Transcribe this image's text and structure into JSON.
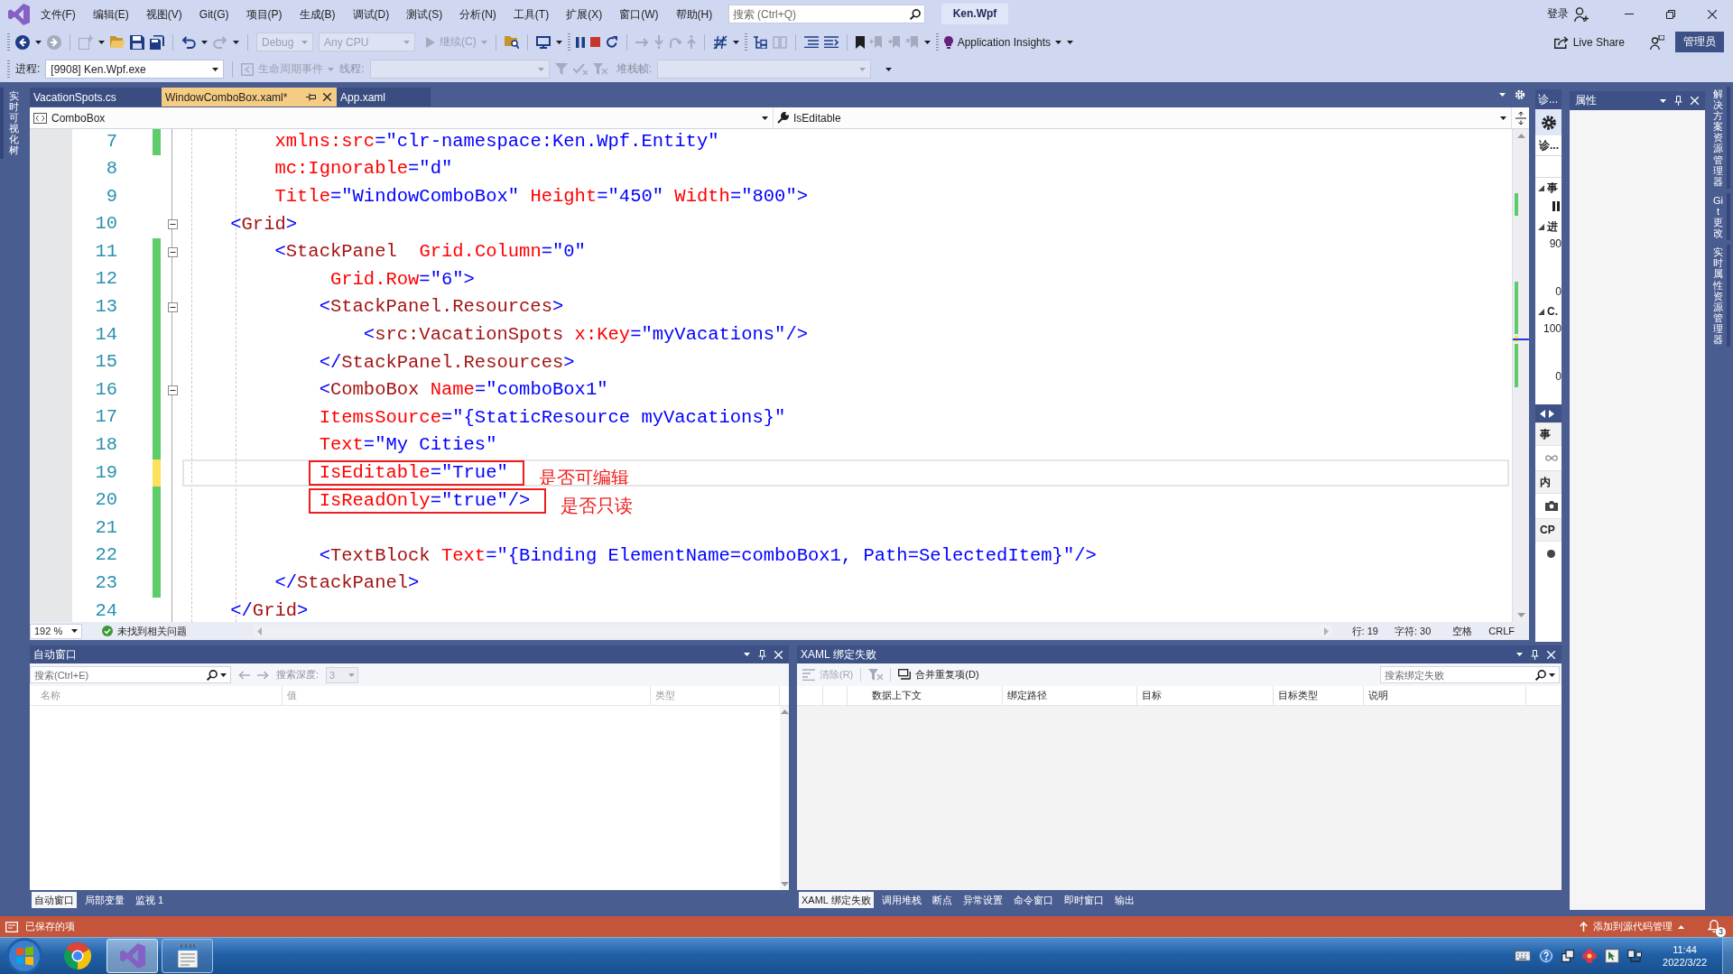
{
  "menu_bar": {
    "items": [
      "文件(F)",
      "编辑(E)",
      "视图(V)",
      "Git(G)",
      "项目(P)",
      "生成(B)",
      "调试(D)",
      "测试(S)",
      "分析(N)",
      "工具(T)",
      "扩展(X)",
      "窗口(W)",
      "帮助(H)"
    ],
    "search": {
      "placeholder": "搜索 (Ctrl+Q)"
    },
    "solution_name": "Ken.Wpf",
    "sign_in": "登录"
  },
  "standard_toolbar": {
    "configuration": {
      "value": "Debug",
      "disabled": true
    },
    "platform": {
      "value": "Any CPU",
      "disabled": true
    },
    "continue": {
      "label": "继续(C)",
      "disabled": true
    },
    "application_insights": "Application Insights",
    "live_share": "Live Share",
    "admin_badge": "管理员"
  },
  "debug_location_toolbar": {
    "process_label": "进程:",
    "process": "[9908] Ken.Wpf.exe",
    "lifecycle_events": {
      "label": "生命周期事件",
      "disabled": true
    },
    "thread": {
      "label": "线程:",
      "disabled": true
    },
    "stack_frame": {
      "label": "堆栈帧:",
      "disabled": true
    }
  },
  "left_rail": [
    "实时可视化树"
  ],
  "document_tabs": [
    {
      "label": "VacationSpots.cs",
      "selected": false
    },
    {
      "label": "WindowComboBox.xaml*",
      "selected": true
    },
    {
      "label": "App.xaml",
      "selected": false
    }
  ],
  "navigation_bar": {
    "scope": "ComboBox",
    "member": "IsEditable"
  },
  "editor": {
    "lines": [
      {
        "number": "7",
        "text": "        xmlns:src=\"clr-namespace:Ken.Wpf.Entity\"",
        "changed": true,
        "color": "#5fcc6a",
        "foldable": false,
        "current": false
      },
      {
        "number": "8",
        "text": "        mc:Ignorable=\"d\"",
        "changed": false,
        "foldable": false,
        "current": false
      },
      {
        "number": "9",
        "text": "        Title=\"WindowComboBox\" Height=\"450\" Width=\"800\">",
        "changed": false,
        "foldable": false,
        "current": false
      },
      {
        "number": "10",
        "text": "    <Grid>",
        "changed": false,
        "foldable": true,
        "current": false
      },
      {
        "number": "11",
        "text": "        <StackPanel  Grid.Column=\"0\"",
        "changed": true,
        "color": "#5fcc6a",
        "foldable": true,
        "current": false
      },
      {
        "number": "12",
        "text": "             Grid.Row=\"6\">",
        "changed": true,
        "color": "#5fcc6a",
        "foldable": false,
        "current": false
      },
      {
        "number": "13",
        "text": "            <StackPanel.Resources>",
        "changed": true,
        "color": "#5fcc6a",
        "foldable": true,
        "current": false
      },
      {
        "number": "14",
        "text": "                <src:VacationSpots x:Key=\"myVacations\"/>",
        "changed": true,
        "color": "#5fcc6a",
        "foldable": false,
        "current": false
      },
      {
        "number": "15",
        "text": "            </StackPanel.Resources>",
        "changed": true,
        "color": "#5fcc6a",
        "foldable": false,
        "current": false
      },
      {
        "number": "16",
        "text": "            <ComboBox Name=\"comboBox1\"",
        "changed": true,
        "color": "#5fcc6a",
        "foldable": true,
        "current": false
      },
      {
        "number": "17",
        "text": "            ItemsSource=\"{StaticResource myVacations}\"",
        "changed": true,
        "color": "#5fcc6a",
        "foldable": false,
        "current": false
      },
      {
        "number": "18",
        "text": "            Text=\"My Cities\"",
        "changed": true,
        "color": "#5fcc6a",
        "foldable": false,
        "current": false
      },
      {
        "number": "19",
        "text": "            IsEditable=\"True\"",
        "changed": true,
        "color": "#fde15a",
        "foldable": false,
        "current": true,
        "note": "是否可编辑"
      },
      {
        "number": "20",
        "text": "            IsReadOnly=\"true\"/>",
        "changed": true,
        "color": "#5fcc6a",
        "foldable": false,
        "current": false,
        "note": "是否只读"
      },
      {
        "number": "21",
        "changed": true,
        "color": "#5fcc6a",
        "foldable": false,
        "current": false
      },
      {
        "number": "22",
        "text": "            <TextBlock Text=\"{Binding ElementName=comboBox1, Path=SelectedItem}\"/>",
        "changed": true,
        "color": "#5fcc6a",
        "foldable": false,
        "current": false
      },
      {
        "number": "23",
        "text": "        </StackPanel>",
        "changed": true,
        "color": "#5fcc6a",
        "foldable": false,
        "current": false
      },
      {
        "number": "24",
        "text": "    </Grid>",
        "changed": false,
        "foldable": false,
        "current": false
      }
    ]
  },
  "editor_status": {
    "zoom": "192 %",
    "issues": "未找到相关问题",
    "line": "行: 19",
    "column": "字符: 30",
    "indentation": "空格",
    "line_endings": "CRLF"
  },
  "diagnostics_panel": {
    "title": "诊...",
    "heading": "诊...",
    "graphs": [
      {
        "label": "事",
        "kind": "events"
      },
      {
        "label": "进",
        "kind": "gauge",
        "max": "90",
        "min": "0"
      },
      {
        "label": "C.",
        "kind": "gauge",
        "max": "100",
        "min": "0"
      }
    ],
    "tools": [
      {
        "label": "事",
        "kind": "events"
      },
      {
        "label": "内",
        "kind": "memory"
      },
      {
        "label": "CP",
        "kind": "cpu"
      }
    ]
  },
  "properties_panel": {
    "title": "属性"
  },
  "right_rail": [
    "解决方案资源管理器",
    "Git 更改",
    "实时属性资源管理器"
  ],
  "autos_window": {
    "title": "自动窗口",
    "search": {
      "placeholder": "搜索(Ctrl+E)"
    },
    "depth_label": "搜索深度:",
    "depth": {
      "value": "3",
      "disabled": true
    },
    "columns": [
      "名称",
      "值",
      "类型"
    ],
    "tabs": [
      {
        "label": "自动窗口",
        "selected": true
      },
      {
        "label": "局部变量",
        "selected": false
      },
      {
        "label": "监视 1",
        "selected": false
      }
    ]
  },
  "binding_failures_window": {
    "title": "XAML 绑定失败",
    "clear": {
      "label": "清除(R)",
      "disabled": true
    },
    "merge_duplicates": "合并重复项(D)",
    "search": {
      "placeholder": "搜索绑定失败"
    },
    "columns": [
      "数据上下文",
      "绑定路径",
      "目标",
      "目标类型",
      "说明"
    ],
    "tabs": [
      {
        "label": "XAML 绑定失败",
        "selected": true
      },
      {
        "label": "调用堆栈",
        "selected": false
      },
      {
        "label": "断点",
        "selected": false
      },
      {
        "label": "异常设置",
        "selected": false
      },
      {
        "label": "命令窗口",
        "selected": false
      },
      {
        "label": "即时窗口",
        "selected": false
      },
      {
        "label": "输出",
        "selected": false
      }
    ]
  },
  "status_bar": {
    "message": "已保存的项",
    "source_control": "添加到源代码管理",
    "notification_count": "3"
  },
  "taskbar": {
    "apps": [
      {
        "kind": "browser",
        "running": false,
        "selected": false
      },
      {
        "kind": "ide",
        "running": true,
        "selected": true
      },
      {
        "kind": "notepad",
        "running": true,
        "selected": false
      }
    ],
    "time": "11:44",
    "date": "2022/3/22"
  }
}
